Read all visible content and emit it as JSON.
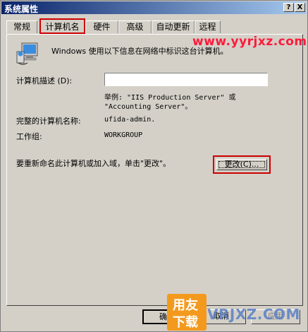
{
  "window": {
    "title": "系统属性",
    "help_glyph": "?",
    "close_glyph": "X"
  },
  "tabs": [
    {
      "label": "常规"
    },
    {
      "label": "计算机名"
    },
    {
      "label": "硬件"
    },
    {
      "label": "高级"
    },
    {
      "label": "自动更新"
    },
    {
      "label": "远程"
    }
  ],
  "panel": {
    "intro": "Windows 使用以下信息在网络中标识这台计算机。",
    "desc_label": "计算机描述 (D):",
    "desc_value": "",
    "example_line1": "举例: \"IIS Production Server\" 或",
    "example_line2": "\"Accounting Server\"。",
    "fullname_label": "完整的计算机名称:",
    "fullname_value": "ufida-admin.",
    "workgroup_label": "工作组:",
    "workgroup_value": "WORKGROUP",
    "rename_text": "要重新命名此计算机或加入域，单击\"更改\"。",
    "change_button": "更改(C)..."
  },
  "buttons": {
    "ok": "确定",
    "cancel": "取消",
    "apply": "应用"
  },
  "watermarks": {
    "top": "www.yyrjxz.com",
    "logo_top": "用友",
    "logo_bottom": "下载",
    "bottom": "VRJXZ.COM"
  },
  "colors": {
    "titlebar": "#0a246a",
    "highlight": "#cc0000",
    "watermark": "#ff1a3a",
    "logo": "#f39a1e"
  }
}
